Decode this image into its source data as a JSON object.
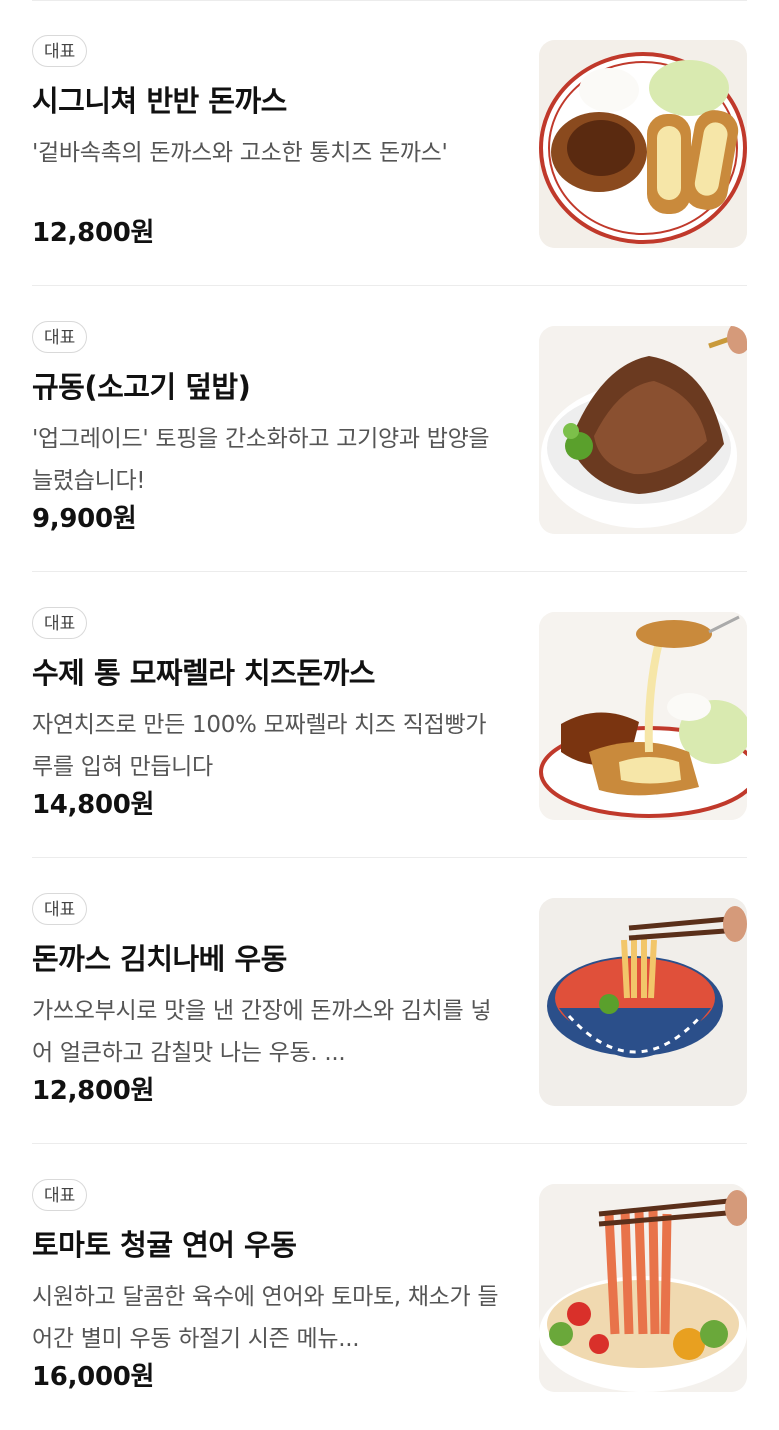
{
  "menu": {
    "items": [
      {
        "badge": "대표",
        "name": "시그니쳐 반반 돈까스",
        "description": "'겉바속촉의 돈까스와 고소한 통치즈 돈까스'",
        "price": "12,800원",
        "image": "tonkatsu-half-plate-image"
      },
      {
        "badge": "대표",
        "name": "규동(소고기 덮밥)",
        "description": "'업그레이드' 토핑을 간소화하고 고기양과 밥양을 늘렸습니다!",
        "price": "9,900원",
        "image": "gyudon-beef-bowl-image"
      },
      {
        "badge": "대표",
        "name": "수제 통 모짜렐라 치즈돈까스",
        "description": "자연치즈로 만든 100% 모짜렐라 치즈 직접빵가루를 입혀 만듭니다",
        "price": "14,800원",
        "image": "mozzarella-cheese-tonkatsu-image"
      },
      {
        "badge": "대표",
        "name": "돈까스 김치나베 우동",
        "description": "가쓰오부시로 맛을 낸 간장에 돈까스와 김치를 넣어 얼큰하고 감칠맛 나는 우동. ...",
        "price": "12,800원",
        "image": "kimchi-nabe-udon-image"
      },
      {
        "badge": "대표",
        "name": "토마토 청귤 연어 우동",
        "description": "시원하고 달콤한 육수에 연어와 토마토, 채소가 들어간 별미 우동 하절기 시즌 메뉴...",
        "price": "16,000원",
        "image": "tomato-salmon-udon-image"
      }
    ]
  }
}
